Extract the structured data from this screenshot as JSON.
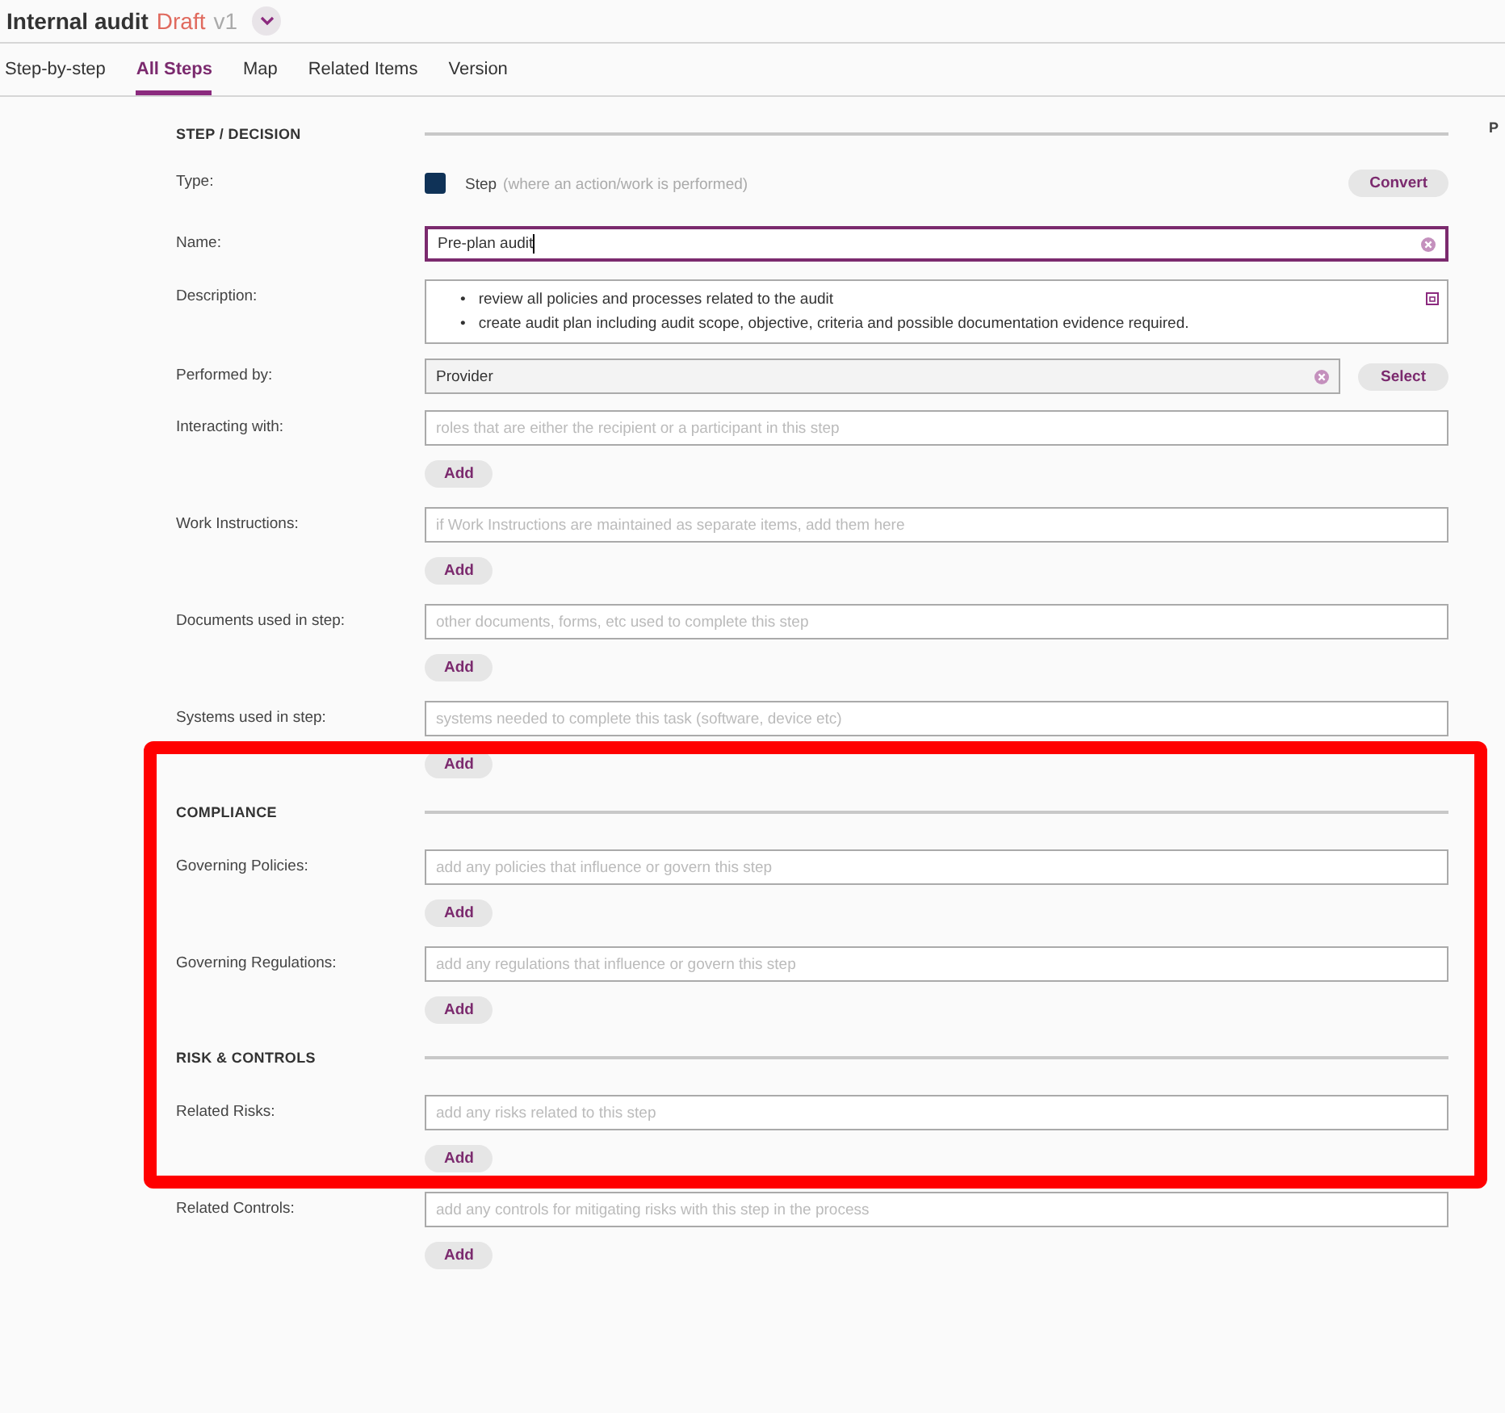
{
  "header": {
    "title": "Internal audit",
    "status": "Draft",
    "version": "v1"
  },
  "tabs": [
    {
      "label": "Step-by-step",
      "selected": false
    },
    {
      "label": "All Steps",
      "selected": true
    },
    {
      "label": "Map",
      "selected": false
    },
    {
      "label": "Related Items",
      "selected": false
    },
    {
      "label": "Version",
      "selected": false
    }
  ],
  "side_heading": "P",
  "sections": [
    {
      "heading": "STEP / DECISION",
      "rows": [
        {
          "kind": "type",
          "label": "Type:",
          "type_name": "Step",
          "hint": "(where an action/work is performed)",
          "button": "Convert"
        },
        {
          "kind": "text",
          "label": "Name:",
          "value": "Pre-plan audit",
          "focused": true
        },
        {
          "kind": "description",
          "label": "Description:",
          "marker": "•",
          "bullets": [
            "review all policies and processes related to the audit",
            "create audit plan including audit scope, objective, criteria and possible documentation evidence required."
          ]
        },
        {
          "kind": "picker",
          "label": "Performed by:",
          "value": "Provider",
          "button": "Select"
        },
        {
          "kind": "list",
          "label": "Interacting with:",
          "placeholder": "roles that are either the recipient or a participant in this step",
          "button": "Add"
        },
        {
          "kind": "list",
          "label": "Work Instructions:",
          "placeholder": "if Work Instructions are maintained as separate items, add them here",
          "button": "Add"
        },
        {
          "kind": "list",
          "label": "Documents used in step:",
          "placeholder": "other documents, forms, etc used to complete this step",
          "button": "Add"
        },
        {
          "kind": "list",
          "label": "Systems used in step:",
          "placeholder": "systems needed to complete this task (software, device etc)",
          "button": "Add"
        }
      ]
    },
    {
      "heading": "COMPLIANCE",
      "rows": [
        {
          "kind": "list",
          "label": "Governing Policies:",
          "placeholder": "add any policies that influence or govern this step",
          "button": "Add"
        },
        {
          "kind": "list",
          "label": "Governing Regulations:",
          "placeholder": "add any regulations that influence or govern this step",
          "button": "Add"
        }
      ]
    },
    {
      "heading": "RISK & CONTROLS",
      "rows": [
        {
          "kind": "list",
          "label": "Related Risks:",
          "placeholder": "add any risks related to this step",
          "button": "Add"
        },
        {
          "kind": "list",
          "label": "Related Controls:",
          "placeholder": "add any controls for mitigating risks with this step in the process",
          "button": "Add"
        }
      ]
    }
  ],
  "annotation": {
    "kind": "frame"
  }
}
